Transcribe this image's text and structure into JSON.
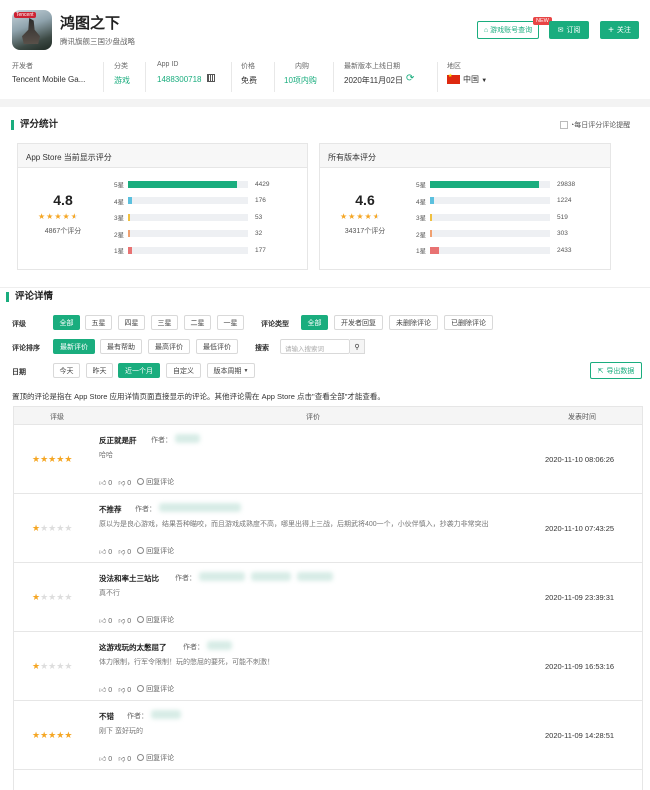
{
  "app": {
    "icon_tag": "Tencent",
    "title": "鸿图之下",
    "subtitle": "腾讯旗舰三国沙盘战略"
  },
  "header_buttons": {
    "account_query": "游戏账号查询",
    "new_badge": "NEW",
    "subscribe": "订阅",
    "follow": "关注"
  },
  "meta": {
    "developer_label": "开发者",
    "developer": "Tencent Mobile Ga...",
    "category_label": "分类",
    "category": "游戏",
    "appid_label": "App ID",
    "appid": "1488300718",
    "price_label": "价格",
    "price": "免费",
    "iap_label": "内购",
    "iap": "10项内购",
    "release_label": "最新版本上线日期",
    "release": "2020年11月02日",
    "region_label": "地区",
    "region": "中国"
  },
  "rating_stats": {
    "title": "评分统计",
    "daily_reminder": "每日评分评论提醒",
    "cards": [
      {
        "title": "App Store 当前显示评分",
        "score": "4.8",
        "stars": 4.5,
        "count_text": "4867个评分",
        "bars": [
          {
            "label": "5星",
            "value": 4429,
            "value_text": "4429",
            "color": "#1aad7e"
          },
          {
            "label": "4星",
            "value": 176,
            "value_text": "176",
            "color": "#5bc0de"
          },
          {
            "label": "3星",
            "value": 53,
            "value_text": "53",
            "color": "#f0c040"
          },
          {
            "label": "2星",
            "value": 32,
            "value_text": "32",
            "color": "#f0a070"
          },
          {
            "label": "1星",
            "value": 177,
            "value_text": "177",
            "color": "#e87272"
          }
        ]
      },
      {
        "title": "所有版本评分",
        "score": "4.6",
        "stars": 4.5,
        "count_text": "34317个评分",
        "bars": [
          {
            "label": "5星",
            "value": 29838,
            "value_text": "29838",
            "color": "#1aad7e"
          },
          {
            "label": "4星",
            "value": 1224,
            "value_text": "1224",
            "color": "#5bc0de"
          },
          {
            "label": "3星",
            "value": 519,
            "value_text": "519",
            "color": "#f0c040"
          },
          {
            "label": "2星",
            "value": 303,
            "value_text": "303",
            "color": "#f0a070"
          },
          {
            "label": "1星",
            "value": 2433,
            "value_text": "2433",
            "color": "#e87272"
          }
        ]
      }
    ]
  },
  "review_details": {
    "title": "评论详情",
    "filters": {
      "rating_label": "评级",
      "rating_options": [
        "全部",
        "五星",
        "四星",
        "三星",
        "二星",
        "一星"
      ],
      "type_label": "评论类型",
      "type_options": [
        "全部",
        "开发者回复",
        "未删除评论",
        "已删除评论"
      ],
      "sort_label": "评论排序",
      "sort_options": [
        "最新评价",
        "最有帮助",
        "最高评价",
        "最低评价"
      ],
      "search_label": "搜索",
      "search_placeholder": "请输入搜索词",
      "date_label": "日期",
      "date_options": [
        "今天",
        "昨天",
        "近一个月",
        "自定义"
      ],
      "version_cycle": "版本周期",
      "export": "导出数据"
    },
    "note": "置顶的评论是指在 App Store 应用详情页面直接显示的评论。其他评论需在 App Store 点击\"查看全部\"才能查看。",
    "table_headers": {
      "rating": "评级",
      "review": "评价",
      "time": "发表时间"
    },
    "author_label": "作者：",
    "reply_label": "回复评论",
    "reviews": [
      {
        "stars": 5,
        "title": "反正就是肝",
        "body": "哈哈",
        "time": "2020-11-10 08:06:26",
        "likes": "0",
        "dislikes": "0"
      },
      {
        "stars": 1,
        "title": "不推荐",
        "body": "原以为是良心游戏，结果吾种瞄咬，而且游戏成熟度不高，哪里出得上三战，后期武将400一个，小伙伴慎入，抄袭力非常突出",
        "time": "2020-11-10 07:43:25",
        "likes": "0",
        "dislikes": "0"
      },
      {
        "stars": 1,
        "title": "没法和率土三站比",
        "body": "真不行",
        "time": "2020-11-09 23:39:31",
        "likes": "0",
        "dislikes": "0"
      },
      {
        "stars": 1,
        "title": "这游戏玩的太憋屈了",
        "body": "体力限制，行军令限制！玩的憋屈的要死，可能不刺激！",
        "time": "2020-11-09 16:53:16",
        "likes": "0",
        "dislikes": "0"
      },
      {
        "stars": 5,
        "title": "不错",
        "body": "刚下 蛮好玩的",
        "time": "2020-11-09 14:28:51",
        "likes": "0",
        "dislikes": "0"
      }
    ]
  }
}
